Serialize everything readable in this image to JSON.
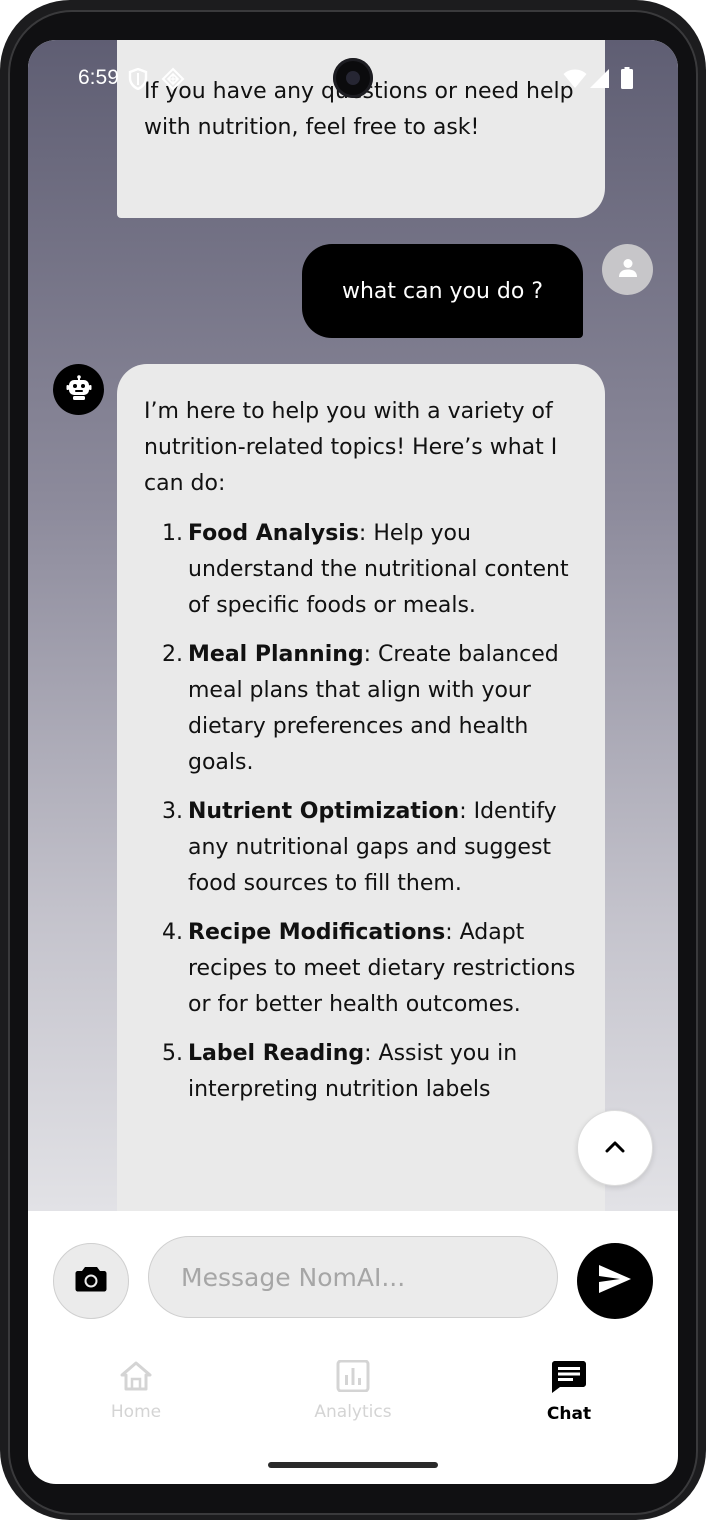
{
  "status_bar": {
    "time": "6:59",
    "left_icons": [
      "shield-icon",
      "diamond-grid-icon"
    ],
    "right_icons": [
      "wifi-icon",
      "cellular-signal-icon",
      "battery-icon"
    ]
  },
  "messages": {
    "previous_bot": {
      "text": "If you have any questions or need help with nutrition, feel free to ask!"
    },
    "user": {
      "text": "what can you do ?",
      "avatar_icon": "person-icon"
    },
    "bot": {
      "avatar_icon": "robot-icon",
      "intro": "I’m here to help you with a variety of nutrition-related topics! Here’s what I can do:",
      "items": [
        {
          "num": "1.",
          "title": "Food Analysis",
          "text": ": Help you understand the nutritional content of specific foods or meals."
        },
        {
          "num": "2.",
          "title": "Meal Planning",
          "text": ": Create balanced meal plans that align with your dietary preferences and health goals."
        },
        {
          "num": "3.",
          "title": "Nutrient Optimization",
          "text": ": Identify any nutritional gaps and suggest food sources to fill them."
        },
        {
          "num": "4.",
          "title": "Recipe Modifications",
          "text": ": Adapt recipes to meet dietary restrictions or for better health outcomes."
        },
        {
          "num": "5.",
          "title": "Label Reading",
          "text": ": Assist you in interpreting nutrition labels"
        }
      ]
    }
  },
  "scroll_top_button": {
    "icon": "chevron-up-icon"
  },
  "composer": {
    "camera_icon": "camera-icon",
    "placeholder": "Message NomAI...",
    "value": "",
    "send_icon": "send-icon"
  },
  "bottom_nav": {
    "items": [
      {
        "label": "Home",
        "icon": "home-icon",
        "active": false
      },
      {
        "label": "Analytics",
        "icon": "analytics-icon",
        "active": false
      },
      {
        "label": "Chat",
        "icon": "chat-icon",
        "active": true
      }
    ]
  },
  "colors": {
    "user_bubble": "#000000",
    "bot_bubble": "#eaeaea",
    "nav_inactive": "#d4d4d4",
    "nav_active": "#000000"
  }
}
